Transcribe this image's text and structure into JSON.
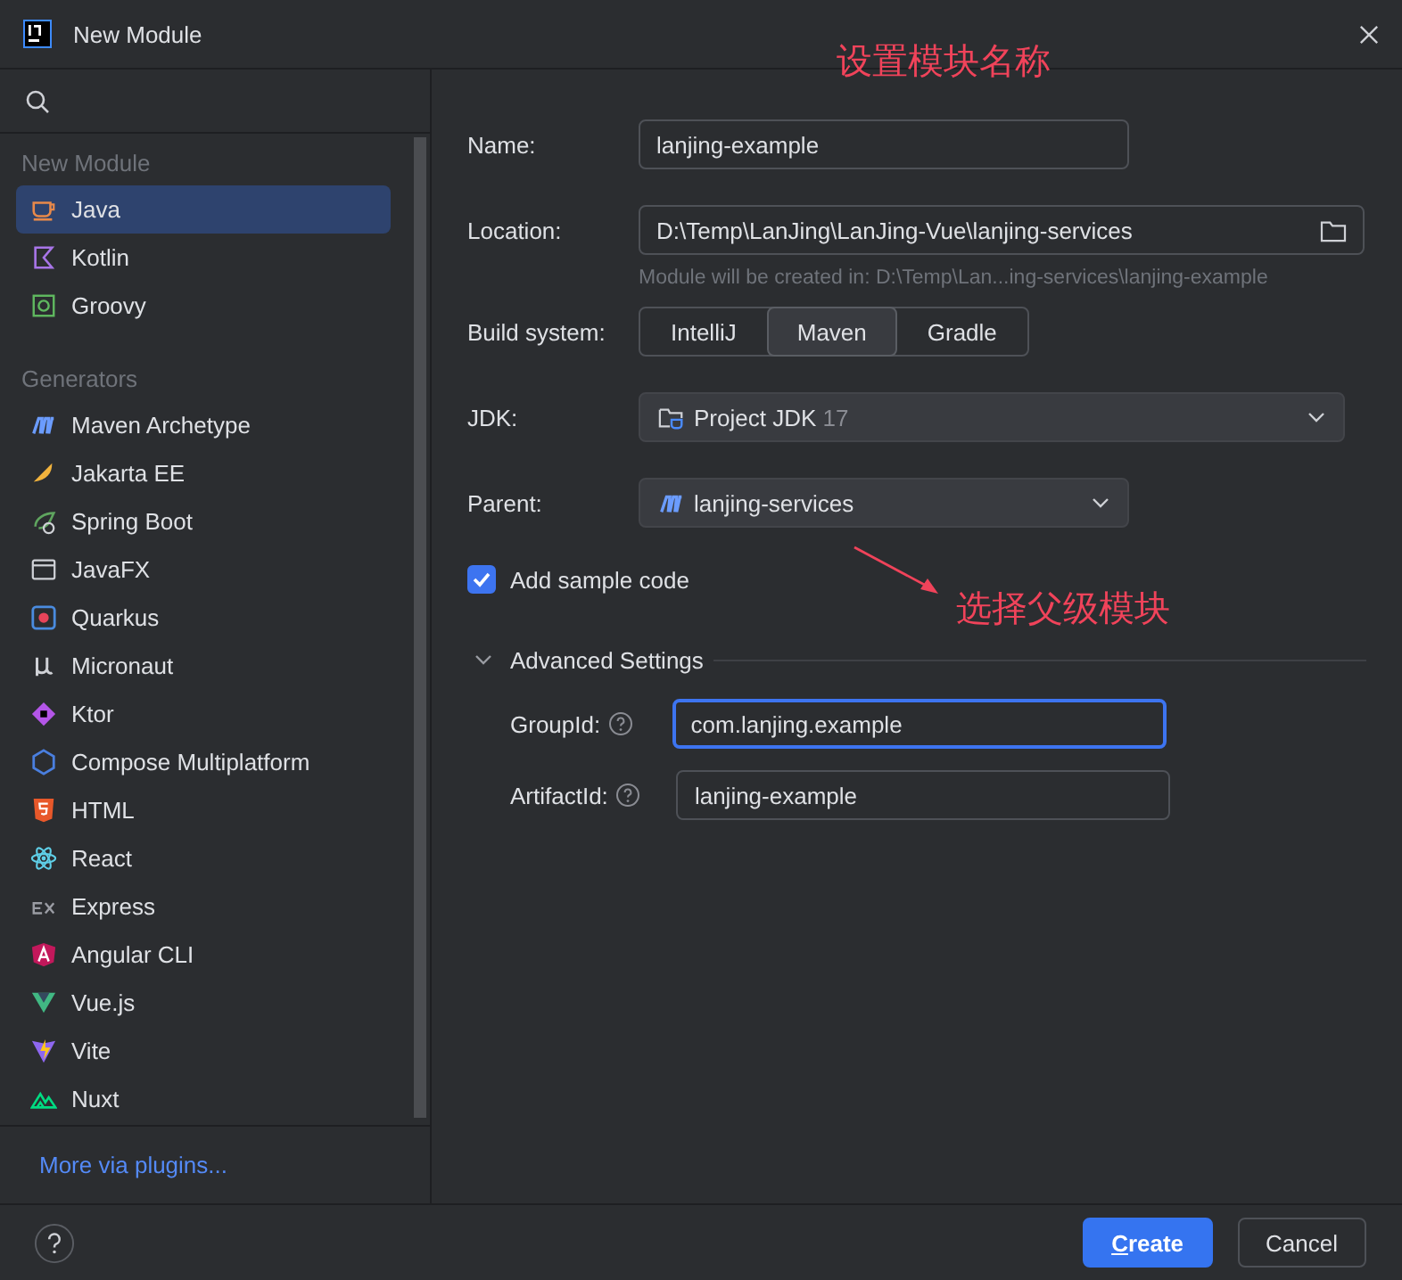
{
  "window": {
    "title": "New Module"
  },
  "sidebar": {
    "sections": [
      {
        "header": "New Module",
        "items": [
          {
            "label": "Java",
            "selected": true
          },
          {
            "label": "Kotlin",
            "selected": false
          },
          {
            "label": "Groovy",
            "selected": false
          }
        ]
      },
      {
        "header": "Generators",
        "items": [
          {
            "label": "Maven Archetype",
            "selected": false
          },
          {
            "label": "Jakarta EE",
            "selected": false
          },
          {
            "label": "Spring Boot",
            "selected": false
          },
          {
            "label": "JavaFX",
            "selected": false
          },
          {
            "label": "Quarkus",
            "selected": false
          },
          {
            "label": "Micronaut",
            "selected": false
          },
          {
            "label": "Ktor",
            "selected": false
          },
          {
            "label": "Compose Multiplatform",
            "selected": false
          },
          {
            "label": "HTML",
            "selected": false
          },
          {
            "label": "React",
            "selected": false
          },
          {
            "label": "Express",
            "selected": false
          },
          {
            "label": "Angular CLI",
            "selected": false
          },
          {
            "label": "Vue.js",
            "selected": false
          },
          {
            "label": "Vite",
            "selected": false
          },
          {
            "label": "Nuxt",
            "selected": false
          }
        ]
      }
    ],
    "more_link": "More via plugins..."
  },
  "form": {
    "name": {
      "label": "Name:",
      "value": "lanjing-example"
    },
    "location": {
      "label": "Location:",
      "value": "D:\\Temp\\LanJing\\LanJing-Vue\\lanjing-services",
      "hint": "Module will be created in: D:\\Temp\\Lan...ing-services\\lanjing-example"
    },
    "build_system": {
      "label": "Build system:",
      "options": [
        {
          "label": "IntelliJ",
          "selected": false
        },
        {
          "label": "Maven",
          "selected": true
        },
        {
          "label": "Gradle",
          "selected": false
        }
      ]
    },
    "jdk": {
      "label": "JDK:",
      "value": "Project JDK",
      "version": "17"
    },
    "parent": {
      "label": "Parent:",
      "value": "lanjing-services"
    },
    "sample_code": {
      "label": "Add sample code",
      "checked": true
    },
    "advanced": {
      "title": "Advanced Settings",
      "expanded": true,
      "fields": [
        {
          "label": "GroupId:",
          "value": "com.lanjing.example",
          "focused": true
        },
        {
          "label": "ArtifactId:",
          "value": "lanjing-example",
          "focused": false
        }
      ]
    }
  },
  "annotations": [
    "设置模块名称",
    "选择父级模块"
  ],
  "buttons": [
    {
      "label": "Create",
      "primary": true,
      "underline_first": true
    },
    {
      "label": "Cancel",
      "primary": false,
      "underline_first": false
    }
  ]
}
